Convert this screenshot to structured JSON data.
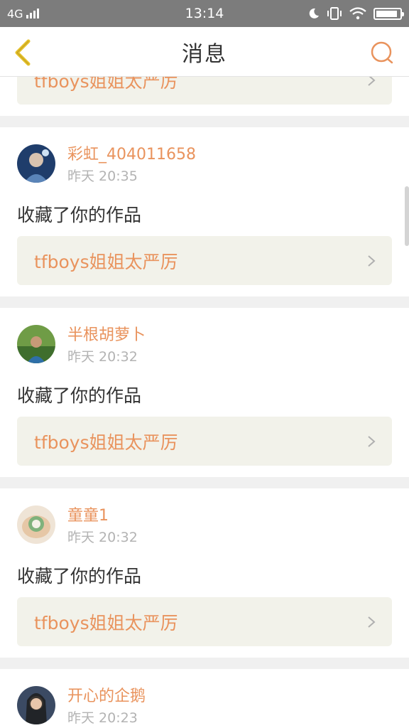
{
  "status_bar": {
    "network": "4G",
    "time": "13:14",
    "battery_level": 0.9
  },
  "nav": {
    "title": "消息"
  },
  "top_partial_card": {
    "work_title": "tfboys姐姐太严厉"
  },
  "messages": [
    {
      "user": "彩虹_404011658",
      "time": "昨天 20:35",
      "action": "收藏了你的作品",
      "work_title": "tfboys姐姐太严厉"
    },
    {
      "user": "半根胡萝卜",
      "time": "昨天 20:32",
      "action": "收藏了你的作品",
      "work_title": "tfboys姐姐太严厉"
    },
    {
      "user": "童童1",
      "time": "昨天 20:32",
      "action": "收藏了你的作品",
      "work_title": "tfboys姐姐太严厉"
    },
    {
      "user": "开心的企鹅",
      "time": "昨天 20:23"
    }
  ],
  "colors": {
    "accent": "#e9935d",
    "back_icon": "#e6c12a",
    "status_bar": "#7c7c7c",
    "link_bg": "#f2f2ea"
  }
}
